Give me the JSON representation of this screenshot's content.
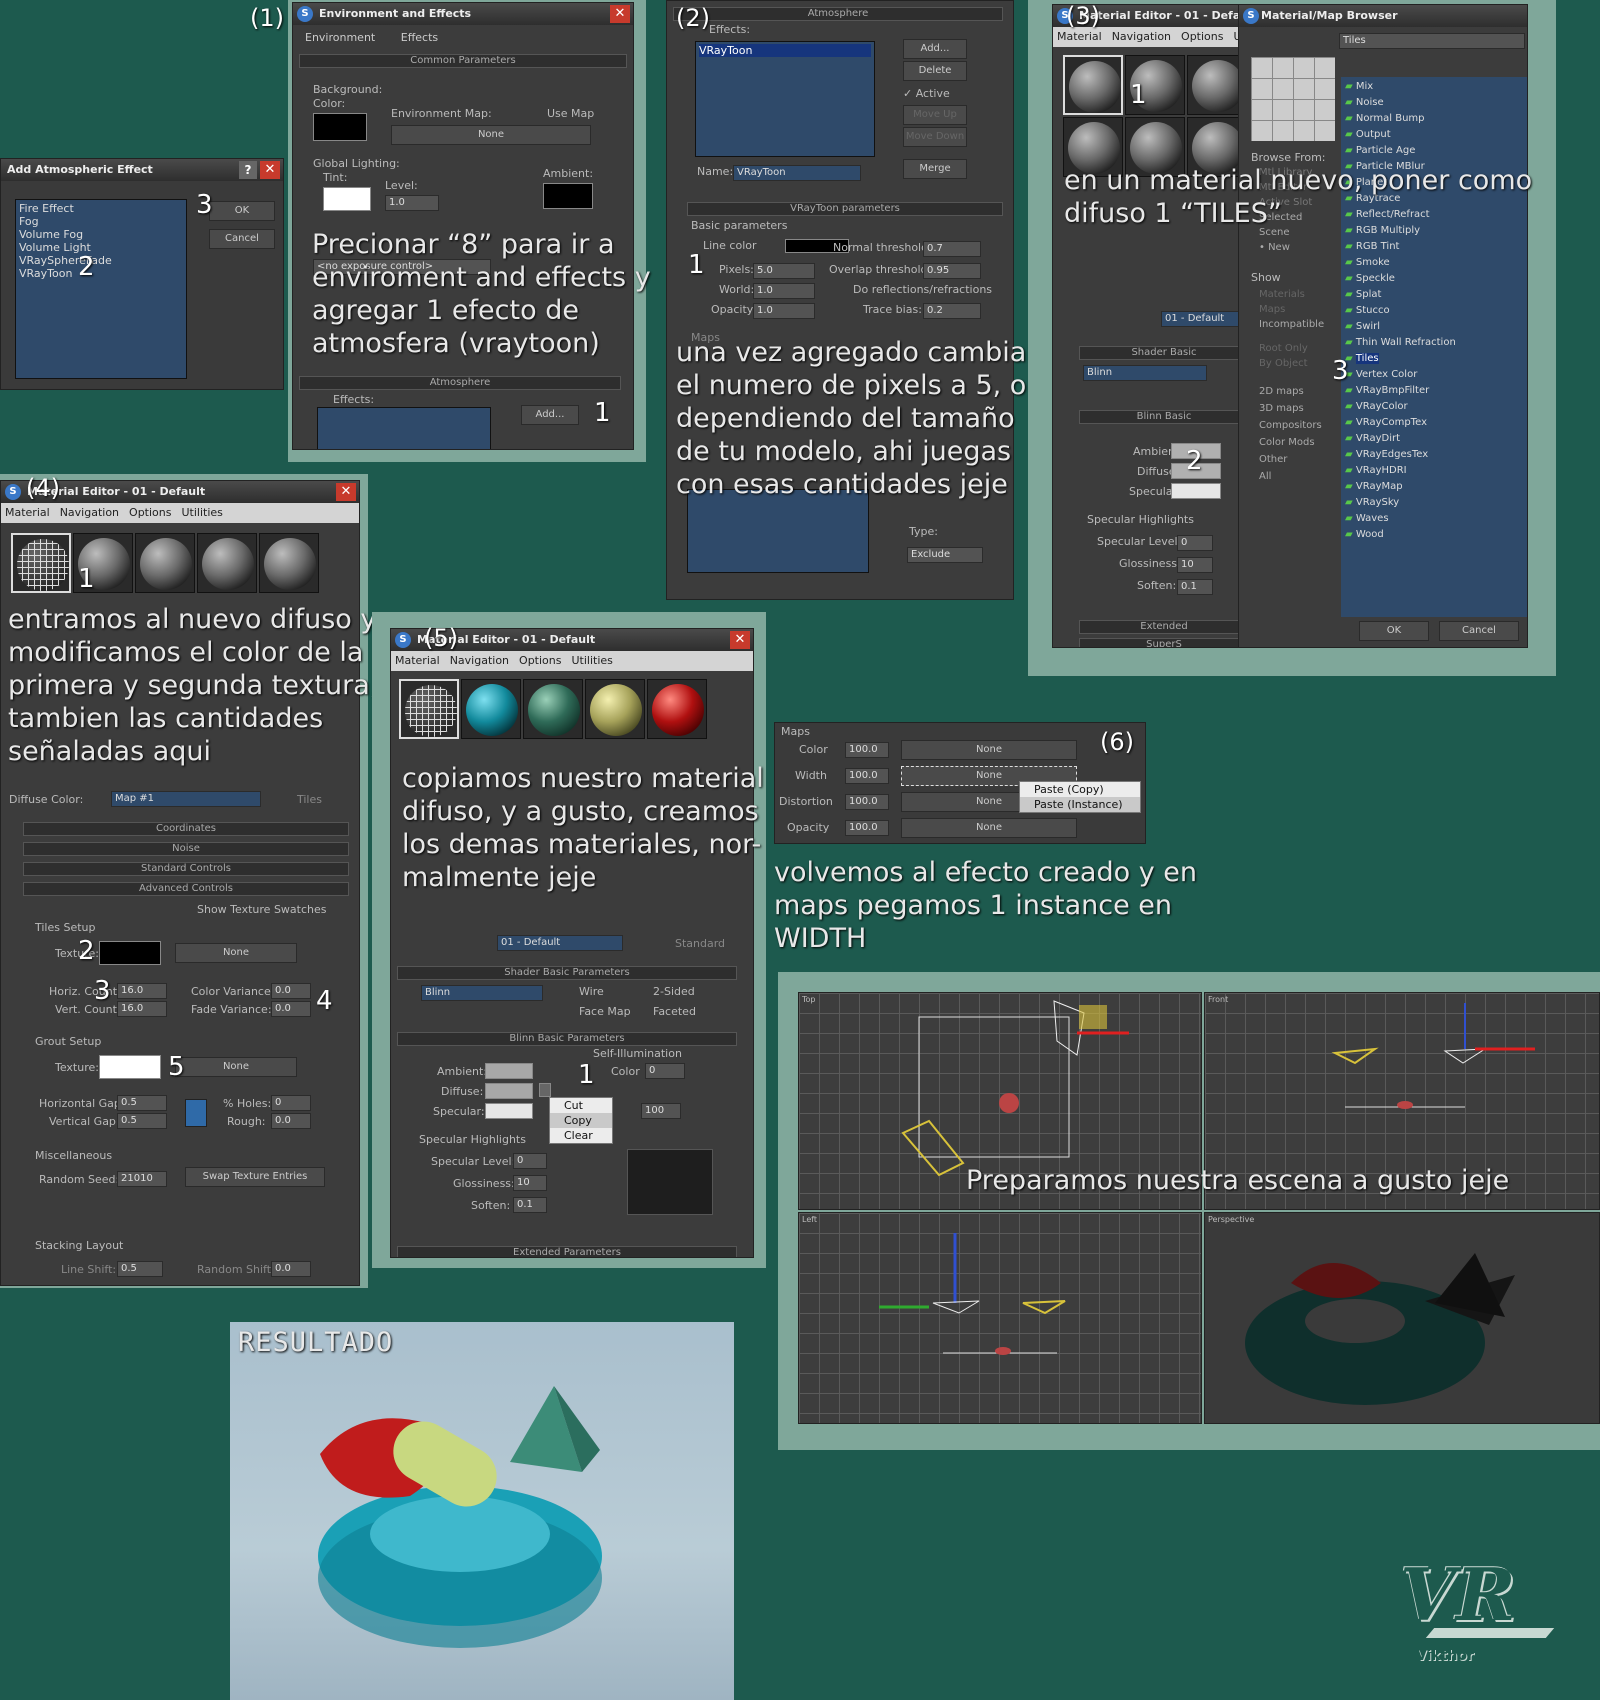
{
  "steps": {
    "s1": "(1)",
    "s2": "(2)",
    "s3": "(3)",
    "s4": "(4)",
    "s5": "(5)",
    "s6": "(6)"
  },
  "step_nums": {
    "one": "1",
    "two": "2",
    "three": "3",
    "four": "4",
    "five": "5"
  },
  "env": {
    "title": "Environment and Effects",
    "tabs": [
      "Environment",
      "Effects"
    ],
    "common": "Common Parameters",
    "background": "Background:",
    "color": "Color:",
    "env_map": "Environment Map:",
    "use_map": "Use Map",
    "none": "None",
    "global_lighting": "Global Lighting:",
    "tint": "Tint:",
    "level": "Level:",
    "level_val": "1.0",
    "ambient": "Ambient:",
    "exposure": "<no exposure control>",
    "atmosphere": "Atmosphere",
    "effects": "Effects:",
    "add": "Add..."
  },
  "add_atmo": {
    "title": "Add Atmospheric Effect",
    "items": [
      "Fire Effect",
      "Fog",
      "Volume Fog",
      "Volume Light",
      "VRaySphereFade",
      "VRayToon"
    ],
    "ok": "OK",
    "cancel": "Cancel"
  },
  "cap1": [
    "Precionar “8” para ir a",
    "enviroment and effects y",
    "agregar 1 efecto de",
    "atmosfera (vraytoon)"
  ],
  "atmo2": {
    "atmosphere": "Atmosphere",
    "effects": "Effects:",
    "item": "VRayToon",
    "add": "Add...",
    "delete": "Delete",
    "active": "Active",
    "move_up": "Move Up",
    "move_down": "Move Down",
    "name_label": "Name:",
    "name_val": "VRayToon",
    "merge": "Merge",
    "params": "VRayToon parameters",
    "basic": "Basic parameters",
    "line_color": "Line color",
    "pixels": "Pixels:",
    "pixels_val": "5.0",
    "world": "World:",
    "world_val": "1.0",
    "opacity": "Opacity:",
    "opacity_val": "1.0",
    "normal_th": "Normal threshold:",
    "normal_th_val": "0.7",
    "overlap_th": "Overlap threshold:",
    "overlap_th_val": "0.95",
    "do_refl": "Do reflections/refractions",
    "trace_bias": "Trace bias:",
    "trace_bias_val": "0.2",
    "maps": "Maps",
    "type": "Type:",
    "exclude": "Exclude"
  },
  "cap2": [
    "una vez agregado cambiar",
    "el numero de pixels a 5, o",
    "dependiendo del tamaño",
    "de tu modelo, ahi juegas",
    "con esas cantidades jeje"
  ],
  "mat3": {
    "title": "Material Editor - 01 - Default",
    "menu": [
      "Material",
      "Navigation",
      "Options",
      "U"
    ],
    "mat_name": "01 - Default",
    "shader": "Shader Basic",
    "blinn": "Blinn",
    "blinn_basic": "Blinn Basic",
    "ambient": "Ambient:",
    "diffuse": "Diffuse:",
    "specular": "Specular:",
    "spec_hl": "Specular Highlights",
    "spec_level": "Specular Level:",
    "spec_level_val": "0",
    "gloss": "Glossiness:",
    "gloss_val": "10",
    "soften": "Soften:",
    "soften_val": "0.1",
    "extended": "Extended",
    "supers": "SuperS"
  },
  "cap3": [
    "en un material nuevo, poner como",
    "difuso 1 “TILES”"
  ],
  "browser": {
    "title": "Material/Map Browser",
    "search": "Tiles",
    "browse_from": "Browse From:",
    "browse": [
      "Mtl Library",
      "Mtl Editor",
      "Active Slot",
      "Selected",
      "Scene",
      "New"
    ],
    "show": "Show",
    "show_opts": [
      "Materials",
      "Maps",
      "Incompatible"
    ],
    "root": [
      "Root Only",
      "By Object"
    ],
    "cats": [
      "2D maps",
      "3D maps",
      "Compositors",
      "Color Mods",
      "Other",
      "All"
    ],
    "maps": [
      "Mix",
      "Noise",
      "Normal Bump",
      "Output",
      "Particle Age",
      "Particle MBlur",
      "Planet",
      "Raytrace",
      "Reflect/Refract",
      "RGB Multiply",
      "RGB Tint",
      "Smoke",
      "Speckle",
      "Splat",
      "Stucco",
      "Swirl",
      "Thin Wall Refraction",
      "Tiles",
      "Vertex Color",
      "VRayBmpFilter",
      "VRayColor",
      "VRayCompTex",
      "VRayDirt",
      "VRayEdgesTex",
      "VRayHDRI",
      "VRayMap",
      "VRaySky",
      "Waves",
      "Wood"
    ],
    "ok": "OK",
    "cancel": "Cancel"
  },
  "mat4": {
    "title": "Material Editor - 01 - Default",
    "menu": [
      "Material",
      "Navigation",
      "Options",
      "Utilities"
    ],
    "diffuse_color": "Diffuse Color:",
    "map": "Map #1",
    "tiles": "Tiles",
    "rollouts": [
      "Coordinates",
      "Noise",
      "Standard Controls",
      "Advanced Controls"
    ],
    "show_swatches": "Show Texture Swatches",
    "tiles_setup": "Tiles Setup",
    "texture": "Texture:",
    "none": "None",
    "horiz": "Horiz. Count:",
    "horiz_val": "16.0",
    "vert": "Vert. Count:",
    "vert_val": "16.0",
    "color_var": "Color Variance:",
    "color_var_val": "0.0",
    "fade_var": "Fade Variance:",
    "fade_var_val": "0.0",
    "grout": "Grout Setup",
    "hgap": "Horizontal Gap:",
    "hgap_val": "0.5",
    "vgap": "Vertical Gap:",
    "vgap_val": "0.5",
    "holes": "% Holes:",
    "holes_val": "0",
    "rough": "Rough:",
    "rough_val": "0.0",
    "misc": "Miscellaneous",
    "seed": "Random Seed:",
    "seed_val": "21010",
    "swap": "Swap Texture Entries",
    "stacking": "Stacking Layout",
    "line_shift": "Line Shift:",
    "line_shift_val": "0.5",
    "random_shift": "Random Shift:",
    "random_shift_val": "0.0"
  },
  "cap4": [
    "entramos al nuevo difuso y",
    "modificamos el color de la",
    "primera y segunda textura,",
    "tambien las cantidades",
    "señaladas aqui"
  ],
  "mat5": {
    "title": "Material Editor - 01 - Default",
    "menu": [
      "Material",
      "Navigation",
      "Options",
      "Utilities"
    ],
    "mat_name": "01 - Default",
    "standard": "Standard",
    "shader": "Shader Basic Parameters",
    "blinn": "Blinn",
    "wire": "Wire",
    "two_sided": "2-Sided",
    "face_map": "Face Map",
    "faceted": "Faceted",
    "blinn_basic": "Blinn Basic Parameters",
    "self_illum": "Self-Illumination",
    "color": "Color",
    "color_val": "0",
    "ambient": "Ambient:",
    "diffuse": "Diffuse:",
    "specular": "Specular:",
    "opacity_val": "100",
    "spec_hl": "Specular Highlights",
    "spec_level": "Specular Level:",
    "spec_level_val": "0",
    "gloss": "Glossiness:",
    "gloss_val": "10",
    "soften": "Soften:",
    "soften_val": "0.1",
    "extended": "Extended Parameters",
    "menu_items": [
      "Cut",
      "Copy",
      "Clear"
    ]
  },
  "cap5": [
    "copiamos nuestro material",
    "difuso, y a gusto, creamos",
    "los demas materiales, nor-",
    "malmente jeje"
  ],
  "maps6": {
    "title": "Maps",
    "rows": [
      {
        "name": "Color",
        "val": "100.0",
        "map": "None"
      },
      {
        "name": "Width",
        "val": "100.0",
        "map": "None"
      },
      {
        "name": "Distortion",
        "val": "100.0",
        "map": "None"
      },
      {
        "name": "Opacity",
        "val": "100.0",
        "map": "None"
      }
    ],
    "menu_items": [
      "Paste (Copy)",
      "Paste (Instance)"
    ]
  },
  "cap6": [
    "volvemos al efecto creado y en",
    "maps pegamos 1 instance en",
    "WIDTH"
  ],
  "viewports": {
    "labels": [
      "Top",
      "Front",
      "Left",
      "Perspective"
    ],
    "caption": "Preparamos nuestra escena a gusto jeje"
  },
  "result": {
    "title": "RESULTADO"
  },
  "logo": {
    "text": "VR",
    "name": "Vikthor"
  }
}
